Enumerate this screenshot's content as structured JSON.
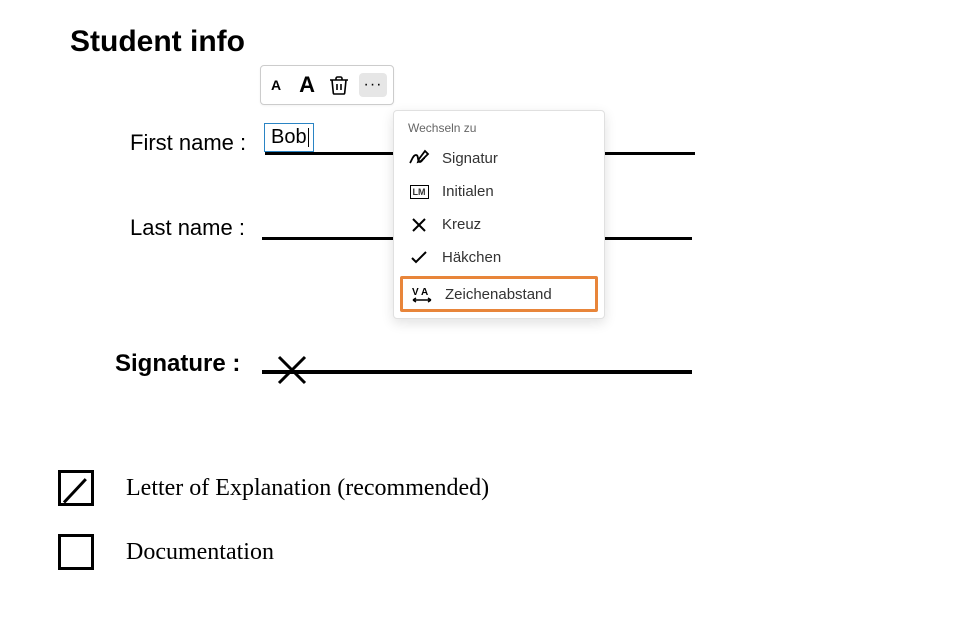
{
  "heading": "Student info",
  "fields": {
    "first_label": "First name :",
    "first_value": "Bob",
    "last_label": "Last name :",
    "signature_label": "Signature :"
  },
  "toolbar": {
    "small_a": "A",
    "big_a": "A",
    "more": "···"
  },
  "dropdown": {
    "header": "Wechseln zu",
    "items": {
      "signature": "Signatur",
      "initials": "Initialen",
      "cross": "Kreuz",
      "check": "Häkchen",
      "spacing": "Zeichenabstand"
    },
    "initials_badge": "LM"
  },
  "checkboxes": {
    "letter": "Letter of Explanation (recommended)",
    "documentation": "Documentation"
  }
}
